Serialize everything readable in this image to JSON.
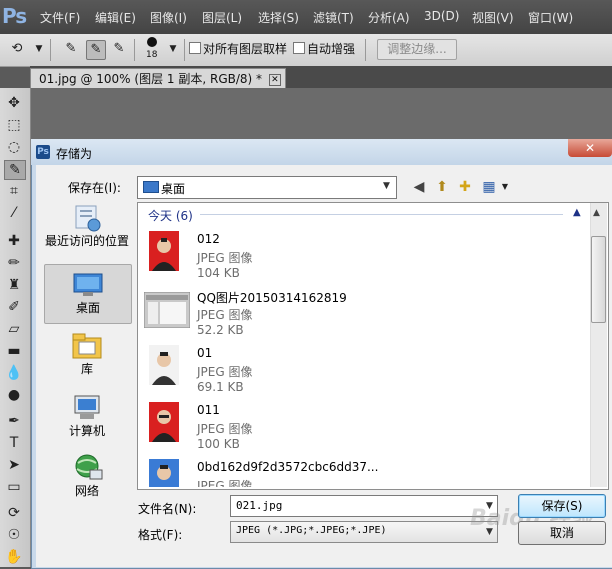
{
  "app": {
    "logo": "Ps"
  },
  "menu": [
    "文件(F)",
    "编辑(E)",
    "图像(I)",
    "图层(L)",
    "选择(S)",
    "滤镜(T)",
    "分析(A)",
    "3D(D)",
    "视图(V)",
    "窗口(W)"
  ],
  "options_bar": {
    "brush_size": "18",
    "sample_all_layers": "对所有图层取样",
    "auto_enhance": "自动增强",
    "refine_edge": "调整边缘..."
  },
  "document_tab": {
    "title": "01.jpg @ 100% (图层 1 副本, RGB/8) *",
    "close": "✕"
  },
  "dialog": {
    "title": "存储为",
    "close": "✕",
    "save_in_label": "保存在(I):",
    "save_in_value": "桌面",
    "places": [
      {
        "label": "最近访问的位置",
        "icon": "recent-places-icon"
      },
      {
        "label": "桌面",
        "icon": "desktop-icon",
        "selected": true
      },
      {
        "label": "库",
        "icon": "libraries-icon"
      },
      {
        "label": "计算机",
        "icon": "computer-icon"
      },
      {
        "label": "网络",
        "icon": "network-icon"
      }
    ],
    "group_header": "今天 (6)",
    "files": [
      {
        "name": "012",
        "type": "JPEG 图像",
        "size": "104 KB",
        "thumb_bg": "#d92020"
      },
      {
        "name": "QQ图片20150314162819",
        "type": "JPEG 图像",
        "size": "52.2 KB",
        "thumb_bg": "#c9c9c9"
      },
      {
        "name": "01",
        "type": "JPEG 图像",
        "size": "69.1 KB",
        "thumb_bg": "#f2f2f2"
      },
      {
        "name": "011",
        "type": "JPEG 图像",
        "size": "100 KB",
        "thumb_bg": "#d92020"
      },
      {
        "name": "0bd162d9f2d3572cbc6dd37...",
        "type": "JPEG 图像",
        "size": "",
        "thumb_bg": "#3a7bd5"
      }
    ],
    "filename_label": "文件名(N):",
    "filename_value": "021.jpg",
    "format_label": "格式(F):",
    "format_value": "JPEG (*.JPG;*.JPEG;*.JPE)",
    "save_button": "保存(S)",
    "cancel_button": "取消"
  },
  "watermark": "Baidu 经验",
  "colors": {
    "accent": "#3c7fb1",
    "group_header": "#1e3287"
  }
}
